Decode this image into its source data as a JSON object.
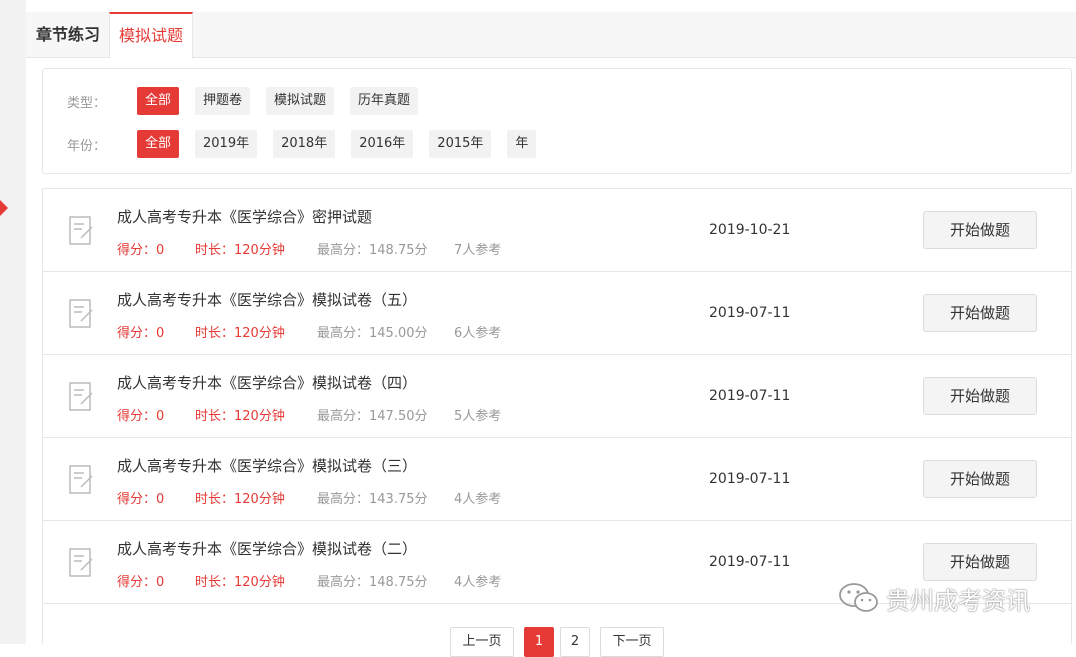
{
  "tabs": [
    {
      "label": "章节练习"
    },
    {
      "label": "模拟试题"
    }
  ],
  "filters": {
    "type_label": "类型：",
    "types": [
      "全部",
      "押题卷",
      "模拟试题",
      "历年真题"
    ],
    "year_label": "年份：",
    "years": [
      "全部",
      "2019年",
      "2018年",
      "2016年",
      "2015年",
      "年"
    ]
  },
  "exams": [
    {
      "title": "成人高考专升本《医学综合》密押试题",
      "score": "得分：0",
      "duration": "时长：120分钟",
      "best": "最高分：148.75分",
      "count": "7人参考",
      "date": "2019-10-21",
      "action": "开始做题"
    },
    {
      "title": "成人高考专升本《医学综合》模拟试卷（五）",
      "score": "得分：0",
      "duration": "时长：120分钟",
      "best": "最高分：145.00分",
      "count": "6人参考",
      "date": "2019-07-11",
      "action": "开始做题"
    },
    {
      "title": "成人高考专升本《医学综合》模拟试卷（四）",
      "score": "得分：0",
      "duration": "时长：120分钟",
      "best": "最高分：147.50分",
      "count": "5人参考",
      "date": "2019-07-11",
      "action": "开始做题"
    },
    {
      "title": "成人高考专升本《医学综合》模拟试卷（三）",
      "score": "得分：0",
      "duration": "时长：120分钟",
      "best": "最高分：143.75分",
      "count": "4人参考",
      "date": "2019-07-11",
      "action": "开始做题"
    },
    {
      "title": "成人高考专升本《医学综合》模拟试卷（二）",
      "score": "得分：0",
      "duration": "时长：120分钟",
      "best": "最高分：148.75分",
      "count": "4人参考",
      "date": "2019-07-11",
      "action": "开始做题"
    }
  ],
  "pagination": {
    "prev": "上一页",
    "pages": [
      "1",
      "2"
    ],
    "next": "下一页"
  },
  "watermark": {
    "text": "贵州成考资讯"
  },
  "colors": {
    "accent": "#e63a36"
  }
}
